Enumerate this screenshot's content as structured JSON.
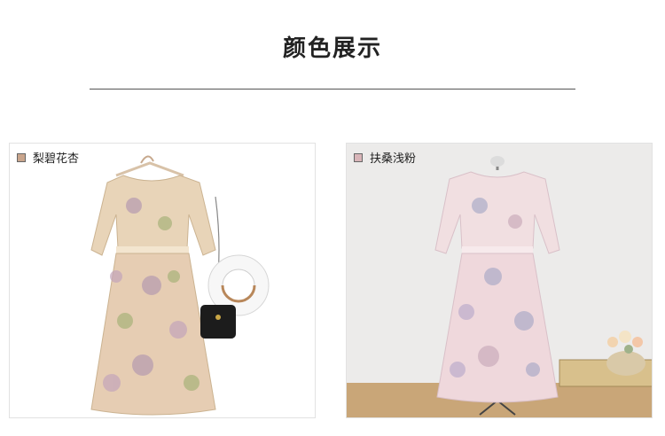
{
  "page": {
    "title": "颜色展示"
  },
  "colors": [
    {
      "name": "梨碧花杏",
      "swatch": "#c9a58c",
      "dress_base": "#e8d4b8",
      "dress_flower": "#b59bb0",
      "dress_leaf": "#a8b27a"
    },
    {
      "name": "扶桑浅粉",
      "swatch": "#d8b4b8",
      "dress_base": "#f1dfe1",
      "dress_flower": "#a7a8c6",
      "dress_leaf": "#d9c0c8"
    }
  ]
}
